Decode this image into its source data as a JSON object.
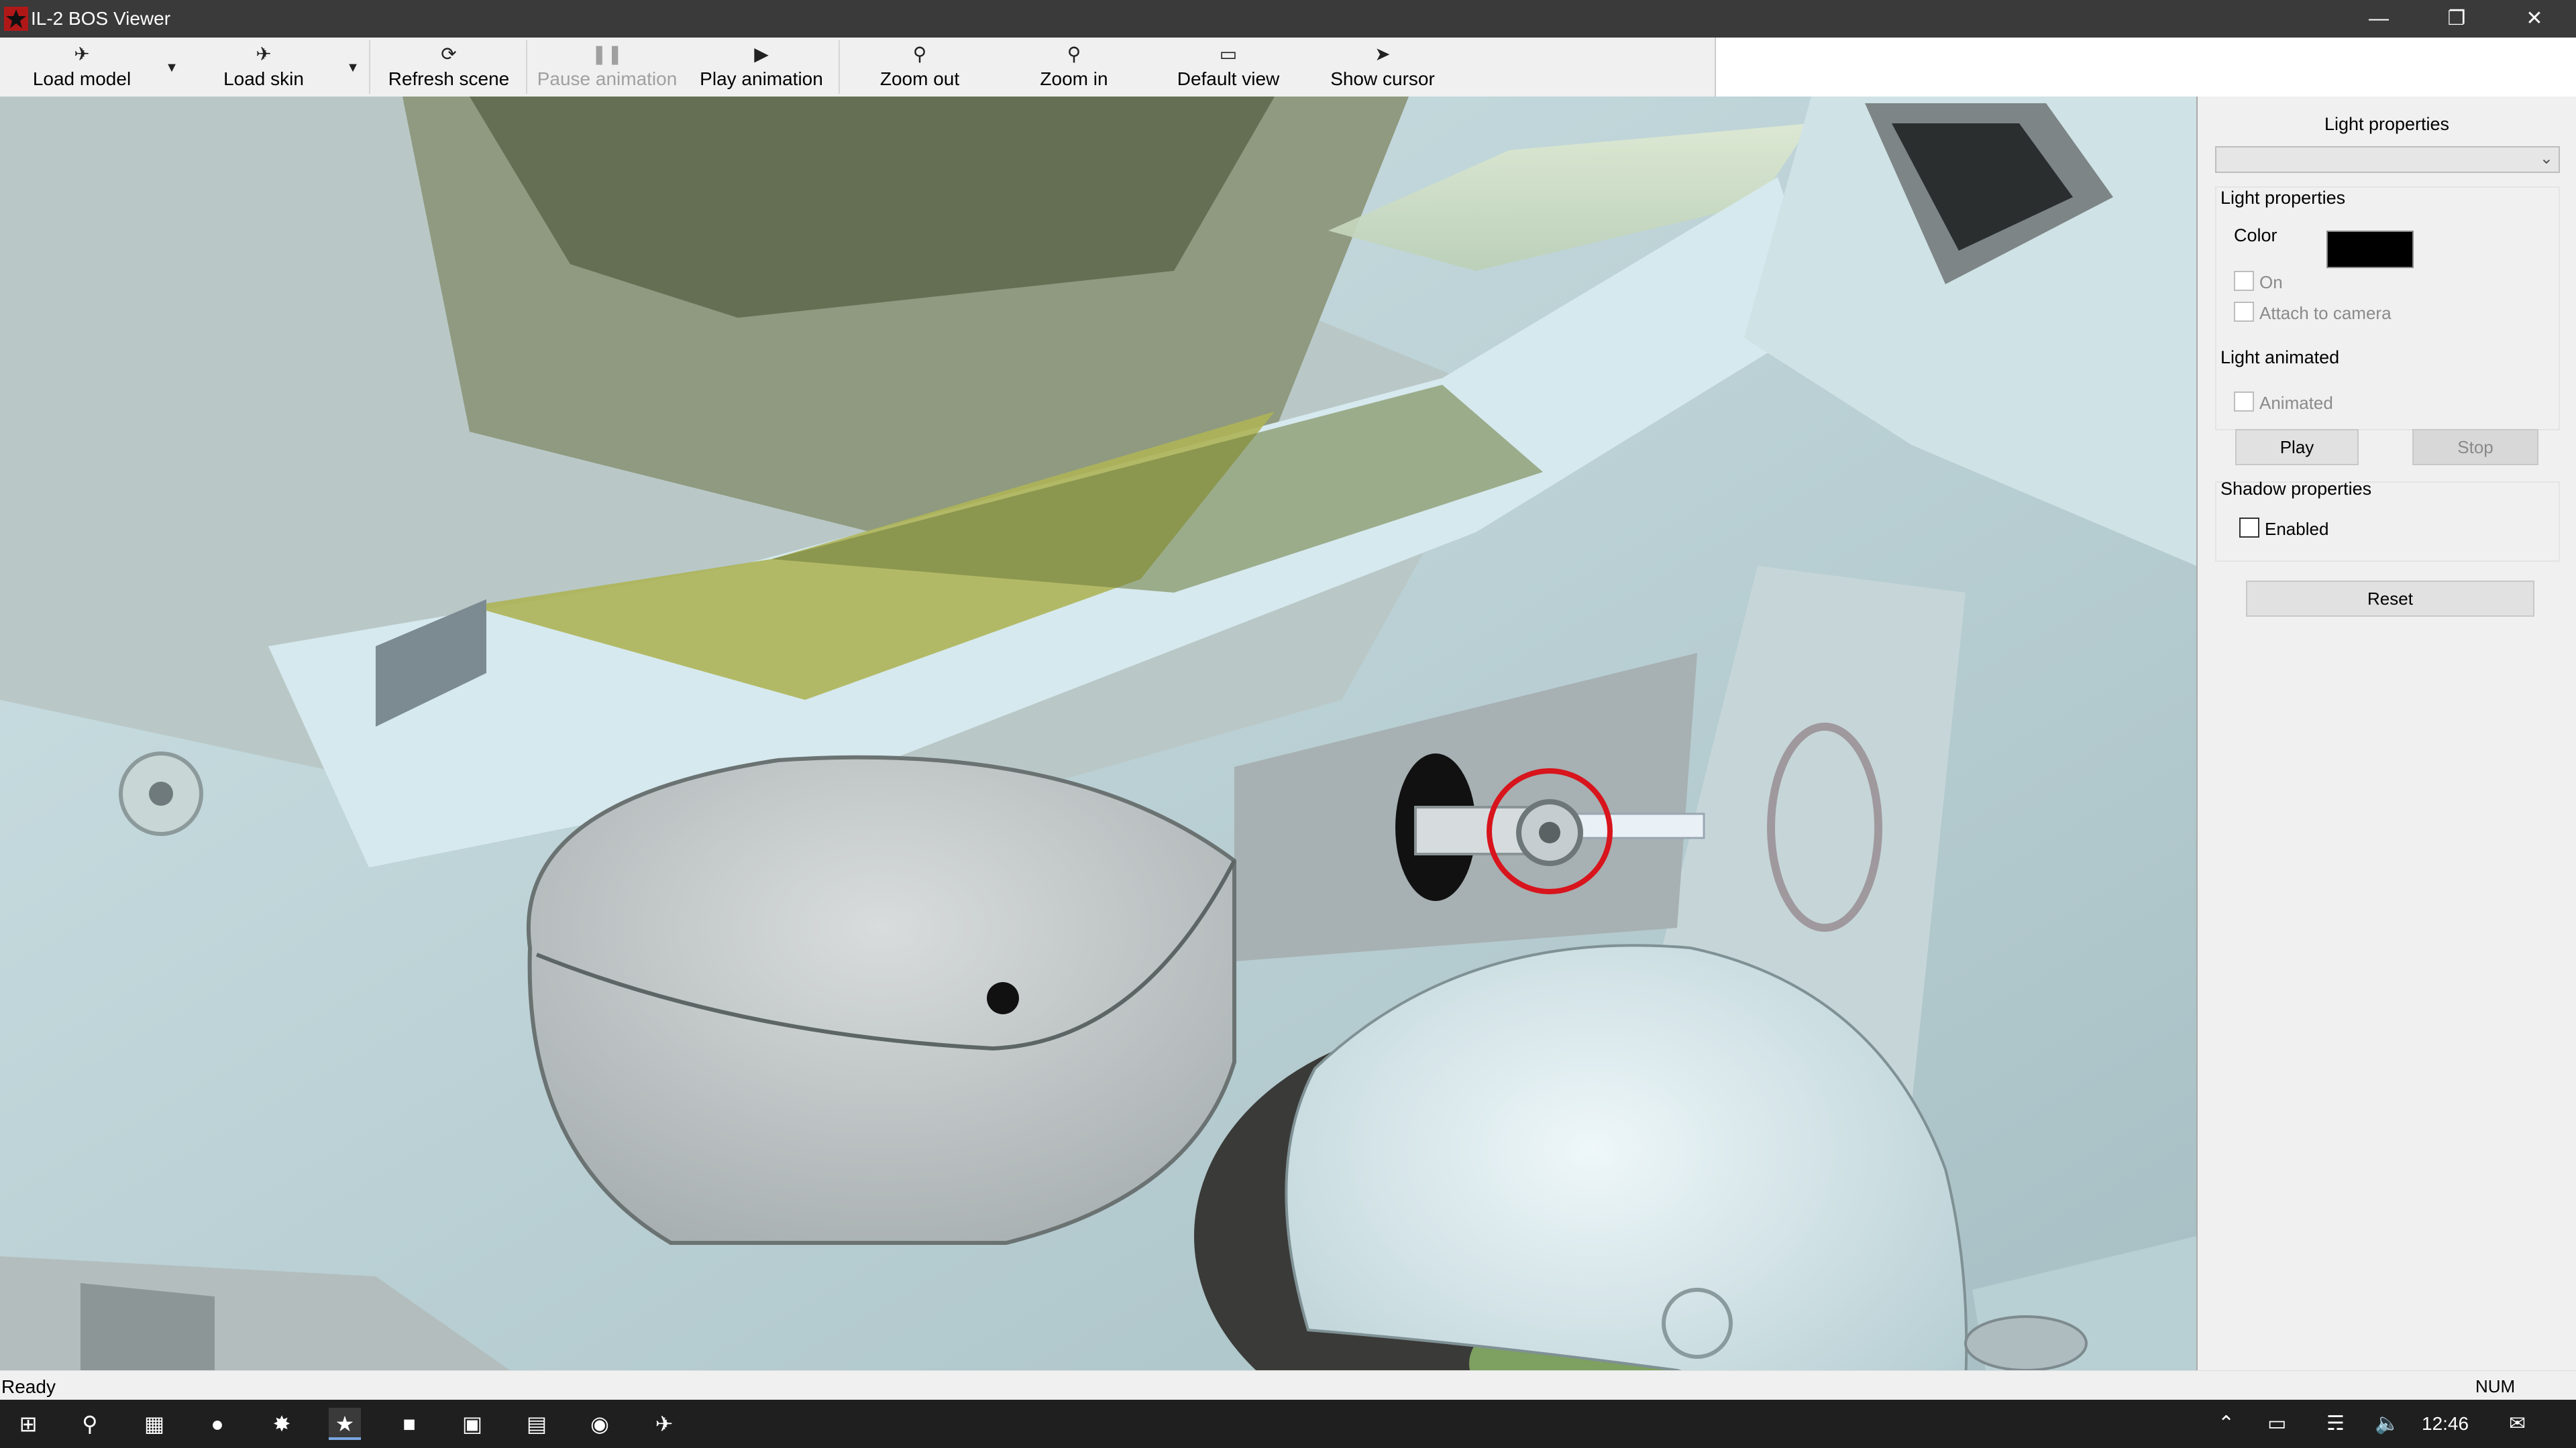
{
  "window": {
    "title": "IL-2 BOS Viewer"
  },
  "toolbar": {
    "load_model": "Load model",
    "load_skin": "Load skin",
    "refresh_scene": "Refresh scene",
    "pause_animation": "Pause animation",
    "play_animation": "Play animation",
    "zoom_out": "Zoom out",
    "zoom_in": "Zoom in",
    "default_view": "Default view",
    "show_cursor": "Show cursor"
  },
  "panel": {
    "header": "Light properties",
    "combo_value": "",
    "light_group": {
      "title": "Light properties",
      "color_label": "Color",
      "color_value": "#000000",
      "on_label": "On",
      "on_checked": false,
      "attach_label": "Attach to camera",
      "attach_checked": false
    },
    "animated_group": {
      "title": "Light animated",
      "animated_label": "Animated",
      "animated_checked": false,
      "play_label": "Play",
      "stop_label": "Stop"
    },
    "shadow_group": {
      "title": "Shadow properties",
      "enabled_label": "Enabled",
      "enabled_checked": false
    },
    "reset_label": "Reset"
  },
  "status": {
    "text": "Ready",
    "num": "NUM"
  },
  "taskbar": {
    "clock": "12:46"
  },
  "colors": {
    "highlight_circle": "#d8141c",
    "titlebar": "#3a3a3a",
    "taskbar": "#1f1f1f"
  }
}
